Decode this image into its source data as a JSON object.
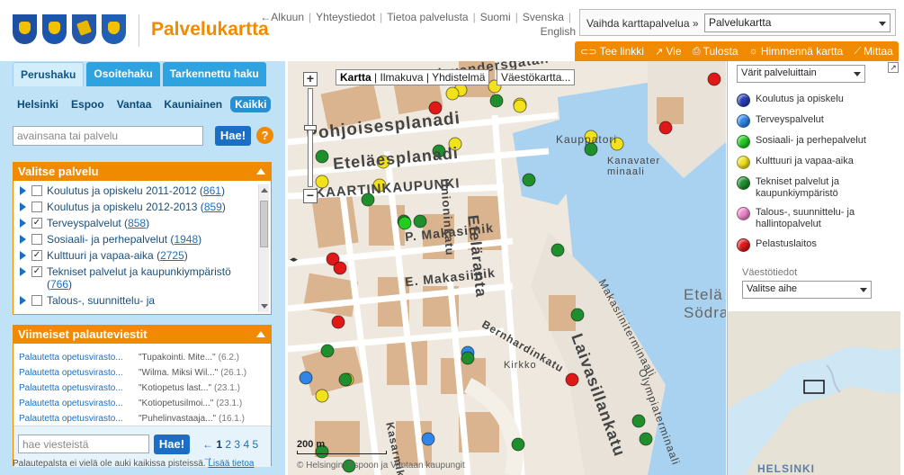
{
  "header": {
    "title": "Palvelukartta",
    "links": [
      "←Alkuun",
      "Yhteystiedot",
      "Tietoa palvelusta",
      "Suomi",
      "Svenska",
      "English"
    ],
    "switcher_label": "Vaihda karttapalvelua »",
    "switcher_value": "Palvelukartta"
  },
  "toolbar": {
    "items": [
      {
        "label": "Tee linkki",
        "icon": "link-icon"
      },
      {
        "label": "Vie",
        "icon": "export-icon"
      },
      {
        "label": "Tulosta",
        "icon": "print-icon"
      },
      {
        "label": "Himmennä kartta",
        "icon": "dim-icon"
      },
      {
        "label": "Mittaa",
        "icon": "ruler-icon"
      }
    ]
  },
  "left": {
    "tabs": [
      "Perushaku",
      "Osoitehaku",
      "Tarkennettu haku"
    ],
    "cities": [
      "Helsinki",
      "Espoo",
      "Vantaa",
      "Kauniainen",
      "Kaikki"
    ],
    "search_placeholder": "avainsana tai palvelu",
    "search_button": "Hae!",
    "help": "?",
    "services_title": "Valitse palvelu",
    "services": [
      {
        "label": "Koulutus ja opiskelu 2011-2012",
        "count": "861",
        "checked": false
      },
      {
        "label": "Koulutus ja opiskelu 2012-2013",
        "count": "859",
        "checked": false
      },
      {
        "label": "Terveyspalvelut",
        "count": "858",
        "checked": true
      },
      {
        "label": "Sosiaali- ja perhepalvelut",
        "count": "1948",
        "checked": false
      },
      {
        "label": "Kulttuuri ja vapaa-aika",
        "count": "2725",
        "checked": true
      },
      {
        "label": "Tekniset palvelut ja kaupunkiympäristö",
        "count": "766",
        "checked": true
      },
      {
        "label": "Talous-, suunnittelu- ja",
        "count": "",
        "checked": false
      }
    ],
    "feedback_title": "Viimeiset palauteviestit",
    "feedback": [
      {
        "to": "Palautetta opetusvirasto...",
        "msg": "\"Tupakointi. Mite...\"",
        "date": "(6.2.)"
      },
      {
        "to": "Palautetta opetusvirasto...",
        "msg": "\"Wilma. Miksi Wil...\"",
        "date": "(26.1.)"
      },
      {
        "to": "Palautetta opetusvirasto...",
        "msg": "\"Kotiopetus last...\"",
        "date": "(23.1.)"
      },
      {
        "to": "Palautetta opetusvirasto...",
        "msg": "\"Kotiopetusilmoi...\"",
        "date": "(23.1.)"
      },
      {
        "to": "Palautetta opetusvirasto...",
        "msg": "\"Puhelinvastaaja...\"",
        "date": "(16.1.)"
      }
    ],
    "feedback_placeholder": "hae viesteistä",
    "feedback_button": "Hae!",
    "pager": {
      "prev": "←",
      "current": "1",
      "pages": [
        "2",
        "3",
        "4",
        "5"
      ],
      "next": "→"
    },
    "notice": "Palautepalsta ei vielä ole auki kaikissa pisteissä.",
    "notice_link": "Lisää tietoa"
  },
  "map": {
    "view_tabs": {
      "active": "Kartta",
      "others": "| Ilmakuva | Yhdistelmä"
    },
    "population_button": "Väestökartta...",
    "labels": [
      {
        "text": "Alexandersgatan",
        "k": "a1"
      },
      {
        "text": "Pohjoisesplanadi",
        "k": "a2"
      },
      {
        "text": "Eteläesplanadi",
        "k": "a3"
      },
      {
        "text": "KAARTINKAUPUNKI",
        "k": "a4"
      },
      {
        "text": "Eteläranta",
        "k": "a5"
      },
      {
        "text": "P. Makasiinik",
        "k": "a6"
      },
      {
        "text": "E. Makasiinik",
        "k": "a7"
      },
      {
        "text": "Laivasillankatu",
        "k": "a8"
      },
      {
        "text": "Kauppatori",
        "k": "a9"
      },
      {
        "text": "Kanavaterminaali",
        "k": "a10"
      },
      {
        "text": "Makasiiniterminaali",
        "k": "a11"
      },
      {
        "text": "Bernhardinkatu",
        "k": "a12"
      },
      {
        "text": "Kasarmikatu",
        "k": "a13"
      },
      {
        "text": "Kirkko",
        "k": "a14"
      },
      {
        "text": "Etelä Södra",
        "k": "a15"
      },
      {
        "text": "Olympiaterminaali",
        "k": "a16"
      },
      {
        "text": "Unioninkatu",
        "k": "a17"
      }
    ],
    "scale_label": "200 m",
    "copyright": "© Helsingin, Espoon ja Vantaan kaupungit"
  },
  "legend": {
    "color_select": "Värit palveluittain",
    "items": [
      {
        "label": "Koulutus ja opiskelu",
        "color": "#2a3fb8"
      },
      {
        "label": "Terveyspalvelut",
        "color": "#2f86e8"
      },
      {
        "label": "Sosiaali- ja perhepalvelut",
        "color": "#22cc22"
      },
      {
        "label": "Kulttuuri ja vapaa-aika",
        "color": "#f2e21c"
      },
      {
        "label": "Tekniset palvelut ja kaupunkiympäristö",
        "color": "#1f8f2e"
      },
      {
        "label": "Talous-, suunnittelu- ja hallintopalvelut",
        "color": "#ee88cc"
      },
      {
        "label": "Pelastuslaitos",
        "color": "#e01818"
      }
    ],
    "population_label": "Väestötiedot",
    "population_select": "Valitse aihe"
  },
  "overview": {
    "label": "HELSINKI"
  }
}
